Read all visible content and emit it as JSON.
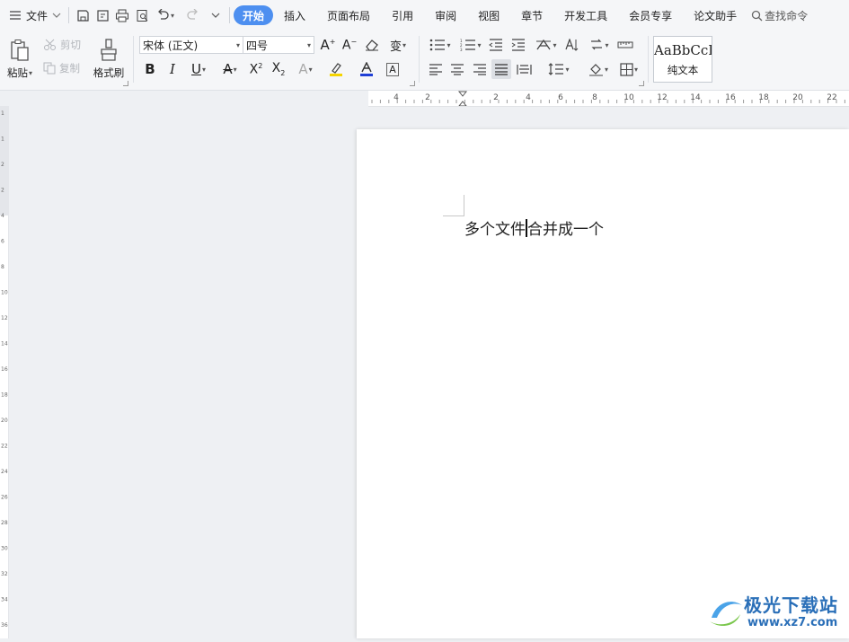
{
  "menubar": {
    "file_label": "文件",
    "tabs": [
      {
        "label": "开始",
        "active": true
      },
      {
        "label": "插入"
      },
      {
        "label": "页面布局"
      },
      {
        "label": "引用"
      },
      {
        "label": "审阅"
      },
      {
        "label": "视图"
      },
      {
        "label": "章节"
      },
      {
        "label": "开发工具"
      },
      {
        "label": "会员专享"
      },
      {
        "label": "论文助手"
      }
    ],
    "search_label": "查找命令"
  },
  "ribbon": {
    "paste_label": "粘贴",
    "cut_label": "剪切",
    "copy_label": "复制",
    "format_painter_label": "格式刷",
    "font_name": "宋体 (正文)",
    "font_size": "四号",
    "style_preview": "AaBbCcI",
    "style_name": "纯文本",
    "accent_color": "#4d8ff0",
    "highlight_color": "#f5d400",
    "font_color": "#1f3fd6"
  },
  "ruler": {
    "h_labels": [
      "4",
      "2",
      "2",
      "4",
      "6",
      "8",
      "10",
      "12",
      "14",
      "16",
      "18",
      "20",
      "22"
    ],
    "v_labels": [
      "1",
      "1",
      "2",
      "2",
      "4",
      "6",
      "8",
      "10",
      "12",
      "14",
      "16",
      "18",
      "20",
      "22",
      "24",
      "26",
      "28",
      "30",
      "32",
      "34",
      "36"
    ]
  },
  "document": {
    "text_before_cursor": "多个文件",
    "text_after_cursor": "合并成一个"
  },
  "watermark": {
    "brand_cn": "极光下载站",
    "brand_url": "www.xz7.com"
  }
}
